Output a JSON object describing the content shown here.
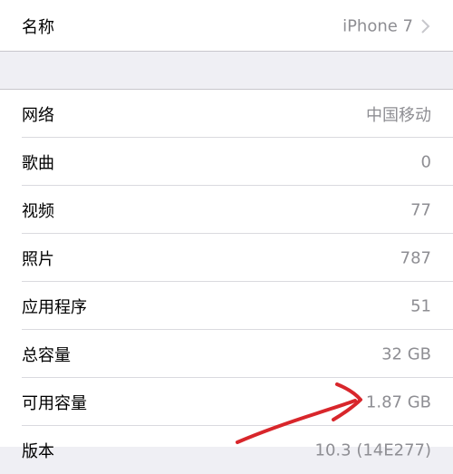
{
  "name_row": {
    "label": "名称",
    "value": "iPhone 7",
    "chevron_icon": "chevron-right-icon"
  },
  "info_rows": [
    {
      "label": "网络",
      "value": "中国移动"
    },
    {
      "label": "歌曲",
      "value": "0"
    },
    {
      "label": "视频",
      "value": "77"
    },
    {
      "label": "照片",
      "value": "787"
    },
    {
      "label": "应用程序",
      "value": "51"
    },
    {
      "label": "总容量",
      "value": "32 GB"
    },
    {
      "label": "可用容量",
      "value": "1.87 GB"
    },
    {
      "label": "版本",
      "value": "10.3 (14E277)"
    }
  ],
  "colors": {
    "background": "#efeff4",
    "value_text": "#8e8e93",
    "annotation_red": "#d8262b"
  }
}
